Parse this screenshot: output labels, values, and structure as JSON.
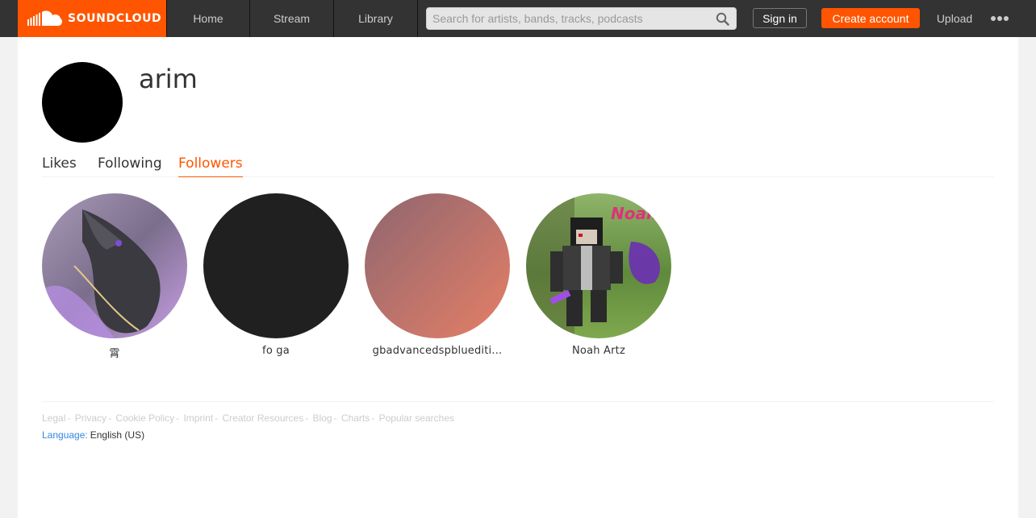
{
  "header": {
    "logo_text": "SOUNDCLOUD",
    "nav": {
      "home": "Home",
      "stream": "Stream",
      "library": "Library"
    },
    "search_placeholder": "Search for artists, bands, tracks, podcasts",
    "sign_in": "Sign in",
    "create_account": "Create account",
    "upload": "Upload",
    "more_icon": "more-dots-icon",
    "brand_color": "#ff5500"
  },
  "profile": {
    "username": "arim"
  },
  "tabs": {
    "likes": "Likes",
    "following": "Following",
    "followers": "Followers",
    "active": "followers"
  },
  "followers": [
    {
      "name": "霄"
    },
    {
      "name": "fo ga"
    },
    {
      "name": "gbadvancedspbluediti..."
    },
    {
      "name": "Noah Artz"
    }
  ],
  "footer": {
    "links": [
      "Legal",
      "Privacy",
      "Cookie Policy",
      "Imprint",
      "Creator Resources",
      "Blog",
      "Charts",
      "Popular searches"
    ],
    "language_label": "Language:",
    "language_value": "English (US)"
  }
}
